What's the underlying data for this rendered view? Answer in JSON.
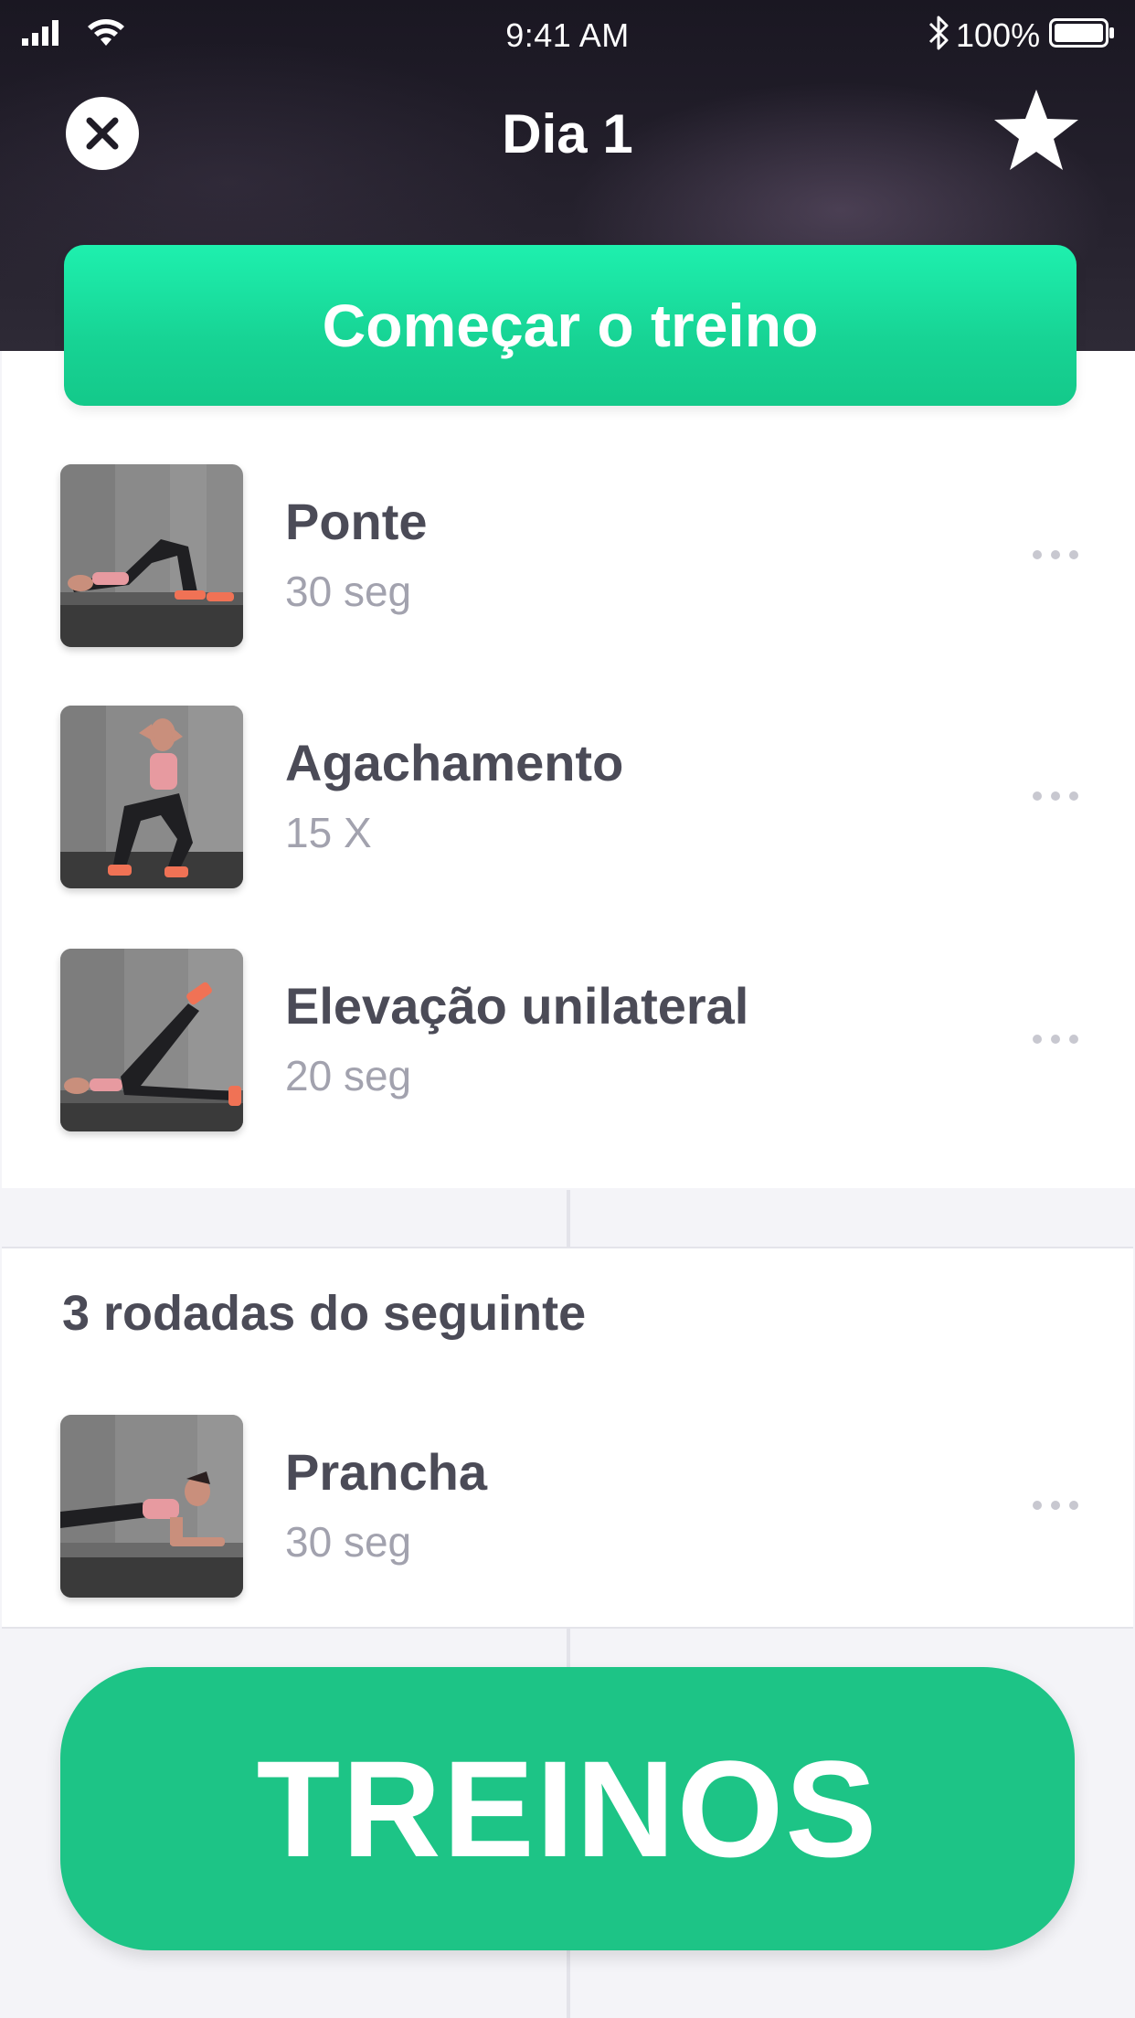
{
  "status_bar": {
    "time": "9:41 AM",
    "battery_percent": "100%",
    "icons": [
      "signal-icon",
      "wifi-icon",
      "bluetooth-icon",
      "battery-icon"
    ]
  },
  "header": {
    "title": "Dia 1",
    "close_icon": "close-icon",
    "favorite_icon": "star-icon"
  },
  "start_button": {
    "label": "Começar o treino"
  },
  "exercises": [
    {
      "name": "Ponte",
      "detail": "30 seg",
      "thumbnail": "glute-bridge-photo"
    },
    {
      "name": "Agachamento",
      "detail": "15 X",
      "thumbnail": "squat-photo"
    },
    {
      "name": "Elevação unilateral",
      "detail": "20 seg",
      "thumbnail": "single-leg-raise-photo"
    }
  ],
  "rounds_section": {
    "label": "3 rodadas do seguinte",
    "exercises": [
      {
        "name": "Prancha",
        "detail": "30 seg",
        "thumbnail": "plank-photo"
      }
    ]
  },
  "bottom_button": {
    "label": "TREINOS"
  },
  "colors": {
    "accent_green": "#1dc486",
    "header_dark": "#1a1722",
    "title_text": "#4b4b57",
    "detail_text": "#a2a2ae"
  }
}
